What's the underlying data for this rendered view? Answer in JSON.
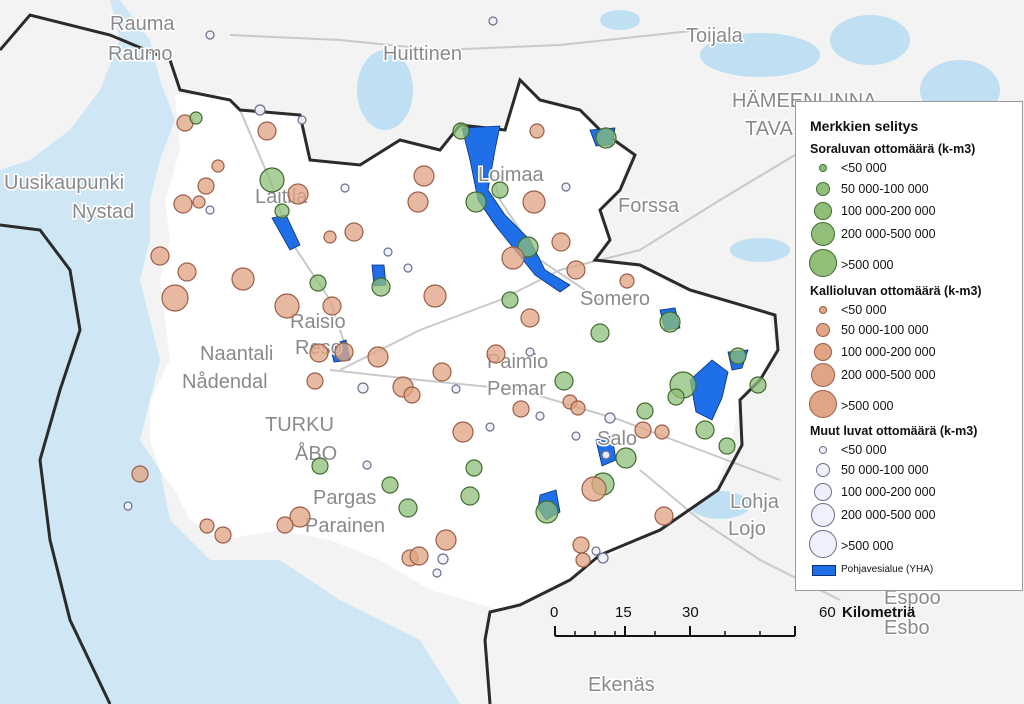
{
  "colors": {
    "sea": "#cfe7f5",
    "land": "#f3f3f3",
    "region": "#ffffff",
    "lake": "#bfe0f2",
    "border": "#2b2b2b",
    "road": "#c9c9c9",
    "gravel_fill": "#8fbf78",
    "gravel_stroke": "#3f6b2e",
    "rock_fill": "#e0a585",
    "rock_stroke": "#9a5e48",
    "other_fill": "#eef1fb",
    "other_stroke": "#6b6f8a",
    "groundwater": "#1e6fe8"
  },
  "place_names": [
    "Rauma",
    "Raumo",
    "Huittinen",
    "Toijala",
    "HÄMEENLINNA",
    "TAVA",
    "Uusikaupunki",
    "Nystad",
    "Laitila",
    "Loimaa",
    "Forssa",
    "Somero",
    "Raisio",
    "Reso",
    "Naantali",
    "Nådendal",
    "Paimio",
    "Pemar",
    "TURKU",
    "ÅBO",
    "Salo",
    "Pargas",
    "Parainen",
    "Lohja",
    "Lojo",
    "Espoo",
    "Esbo",
    "Ekenäs"
  ],
  "legend": {
    "title": "Merkkien selitys",
    "groups": [
      {
        "title": "Soraluvan ottomäärä (k-m3)",
        "kind": "gravel",
        "items": [
          "<50 000",
          "50 000-100 000",
          "100 000-200 000",
          "200 000-500 000",
          ">500 000"
        ]
      },
      {
        "title": "Kallioluvan ottomäärä (k-m3)",
        "kind": "rock",
        "items": [
          "<50 000",
          "50 000-100 000",
          "100 000-200 000",
          "200 000-500 000",
          ">500 000"
        ]
      },
      {
        "title": "Muut luvat ottomäärä (k-m3)",
        "kind": "other",
        "items": [
          "<50 000",
          "50 000-100 000",
          "100 000-200 000",
          "200 000-500 000",
          ">500 000"
        ]
      }
    ],
    "groundwater_label": "Pohjavesialue (YHA)"
  },
  "scalebar": {
    "ticks": [
      "0",
      "15",
      "30",
      "60"
    ],
    "unit": "Kilometriä"
  }
}
